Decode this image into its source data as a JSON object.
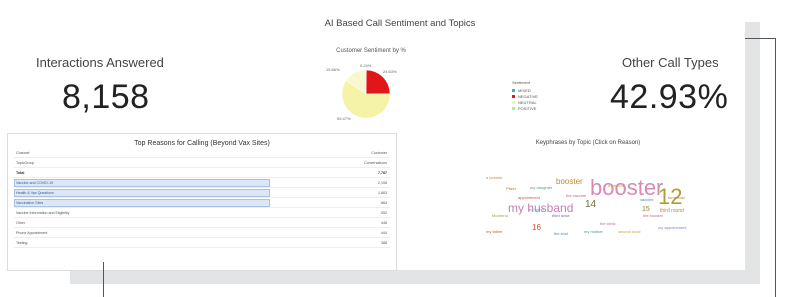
{
  "dashboard": {
    "title": "AI Based Call Sentiment and Topics"
  },
  "kpi_left": {
    "label": "Interactions Answered",
    "value": "8,158"
  },
  "kpi_right": {
    "label": "Other Call Types",
    "value": "42.93%"
  },
  "sentiment_chart": {
    "title": "Customer Sentiment by %",
    "slices": [
      {
        "name": "MIXED",
        "value": 0.24,
        "label": "0.24%",
        "color": "#4fa3d9"
      },
      {
        "name": "NEGATIVE",
        "value": 24.63,
        "label": "24.63%",
        "color": "#e0161a"
      },
      {
        "name": "POSITIVE",
        "value": 0.0,
        "label": "",
        "color": "#b7e3b0"
      },
      {
        "name": "NEUTRAL",
        "value": 59.47,
        "label": "59.47%",
        "color": "#f4f3a6"
      },
      {
        "name": "OTHER",
        "value": 15.66,
        "label": "15.66%",
        "color": "#f7f7d0"
      }
    ]
  },
  "legend": {
    "title": "Sentiment",
    "items": [
      {
        "label": "MIXED",
        "color": "#4fa3d9"
      },
      {
        "label": "NEGATIVE",
        "color": "#e0161a"
      },
      {
        "label": "NEUTRAL",
        "color": "#f4f3a6"
      },
      {
        "label": "POSITIVE",
        "color": "#b7e3b0"
      }
    ]
  },
  "reasons_table": {
    "title": "Top Reasons for Calling (Beyond Vax Sites)",
    "header_col1": "Channel",
    "header_col2": "Customer",
    "subheader_col1": "TopicGroup",
    "subheader_col2": "Conversations",
    "rows": [
      {
        "label": "Total",
        "value": "7,787",
        "highlight": false,
        "bold": true
      },
      {
        "label": "Vaccine and COVID-19",
        "value": "2,198",
        "highlight": true,
        "bold": false
      },
      {
        "label": "Health & Vax Questions",
        "value": "1,883",
        "highlight": true,
        "bold": false
      },
      {
        "label": "Vaccination Sites",
        "value": "864",
        "highlight": true,
        "bold": false
      },
      {
        "label": "Vaccine Information and Eligibility",
        "value": "552",
        "highlight": false,
        "bold": false
      },
      {
        "label": "Other",
        "value": "448",
        "highlight": false,
        "bold": false
      },
      {
        "label": "Phone Appointment",
        "value": "444",
        "highlight": false,
        "bold": false
      },
      {
        "label": "Testing",
        "value": "388",
        "highlight": false,
        "bold": false
      }
    ]
  },
  "keyphrases": {
    "title": "Keyphrases by Topic (Click on Reason)",
    "words": [
      {
        "text": "booster",
        "color": "#d98ab3",
        "size": 22
      },
      {
        "text": "my husband",
        "color": "#c57fb0",
        "size": 12
      },
      {
        "text": "12",
        "color": "#a9a232",
        "size": 22
      },
      {
        "text": "booster",
        "color": "#b88a3a",
        "size": 8
      },
      {
        "text": "14",
        "color": "#7a6a3a",
        "size": 10
      },
      {
        "text": "15",
        "color": "#8a7a3a",
        "size": 7
      },
      {
        "text": "16",
        "color": "#d2503a",
        "size": 8
      },
      {
        "text": "third round",
        "color": "#c28a2a",
        "size": 5
      },
      {
        "text": "a booster",
        "color": "#d08a3a",
        "size": 4
      },
      {
        "text": "my sister",
        "color": "#6a9acb",
        "size": 4
      },
      {
        "text": "vaccine",
        "color": "#3a8ac0",
        "size": 4
      },
      {
        "text": "the vaccine",
        "color": "#c95b82",
        "size": 4
      },
      {
        "text": "a vaccine",
        "color": "#c4a23a",
        "size": 4
      },
      {
        "text": "Pfizer",
        "color": "#cf6f2a",
        "size": 4
      },
      {
        "text": "my daughter",
        "color": "#4aa08a",
        "size": 4
      },
      {
        "text": "the booster",
        "color": "#c96b6b",
        "size": 4
      },
      {
        "text": "third dose",
        "color": "#8a5aa0",
        "size": 4
      },
      {
        "text": "second dose",
        "color": "#cfa24a",
        "size": 4
      },
      {
        "text": "my mother",
        "color": "#3a9a9a",
        "size": 4
      },
      {
        "text": "appointment",
        "color": "#c45a5a",
        "size": 4
      },
      {
        "text": "my appointment",
        "color": "#7a8ac8",
        "size": 4
      },
      {
        "text": "the clinic",
        "color": "#c86aa0",
        "size": 4
      },
      {
        "text": "Moderna",
        "color": "#9aaa3a",
        "size": 4
      },
      {
        "text": "my father",
        "color": "#d05a3a",
        "size": 4
      },
      {
        "text": "the shot",
        "color": "#4a8ab8",
        "size": 4
      },
      {
        "text": "tomorrow",
        "color": "#b8703a",
        "size": 4
      }
    ]
  }
}
